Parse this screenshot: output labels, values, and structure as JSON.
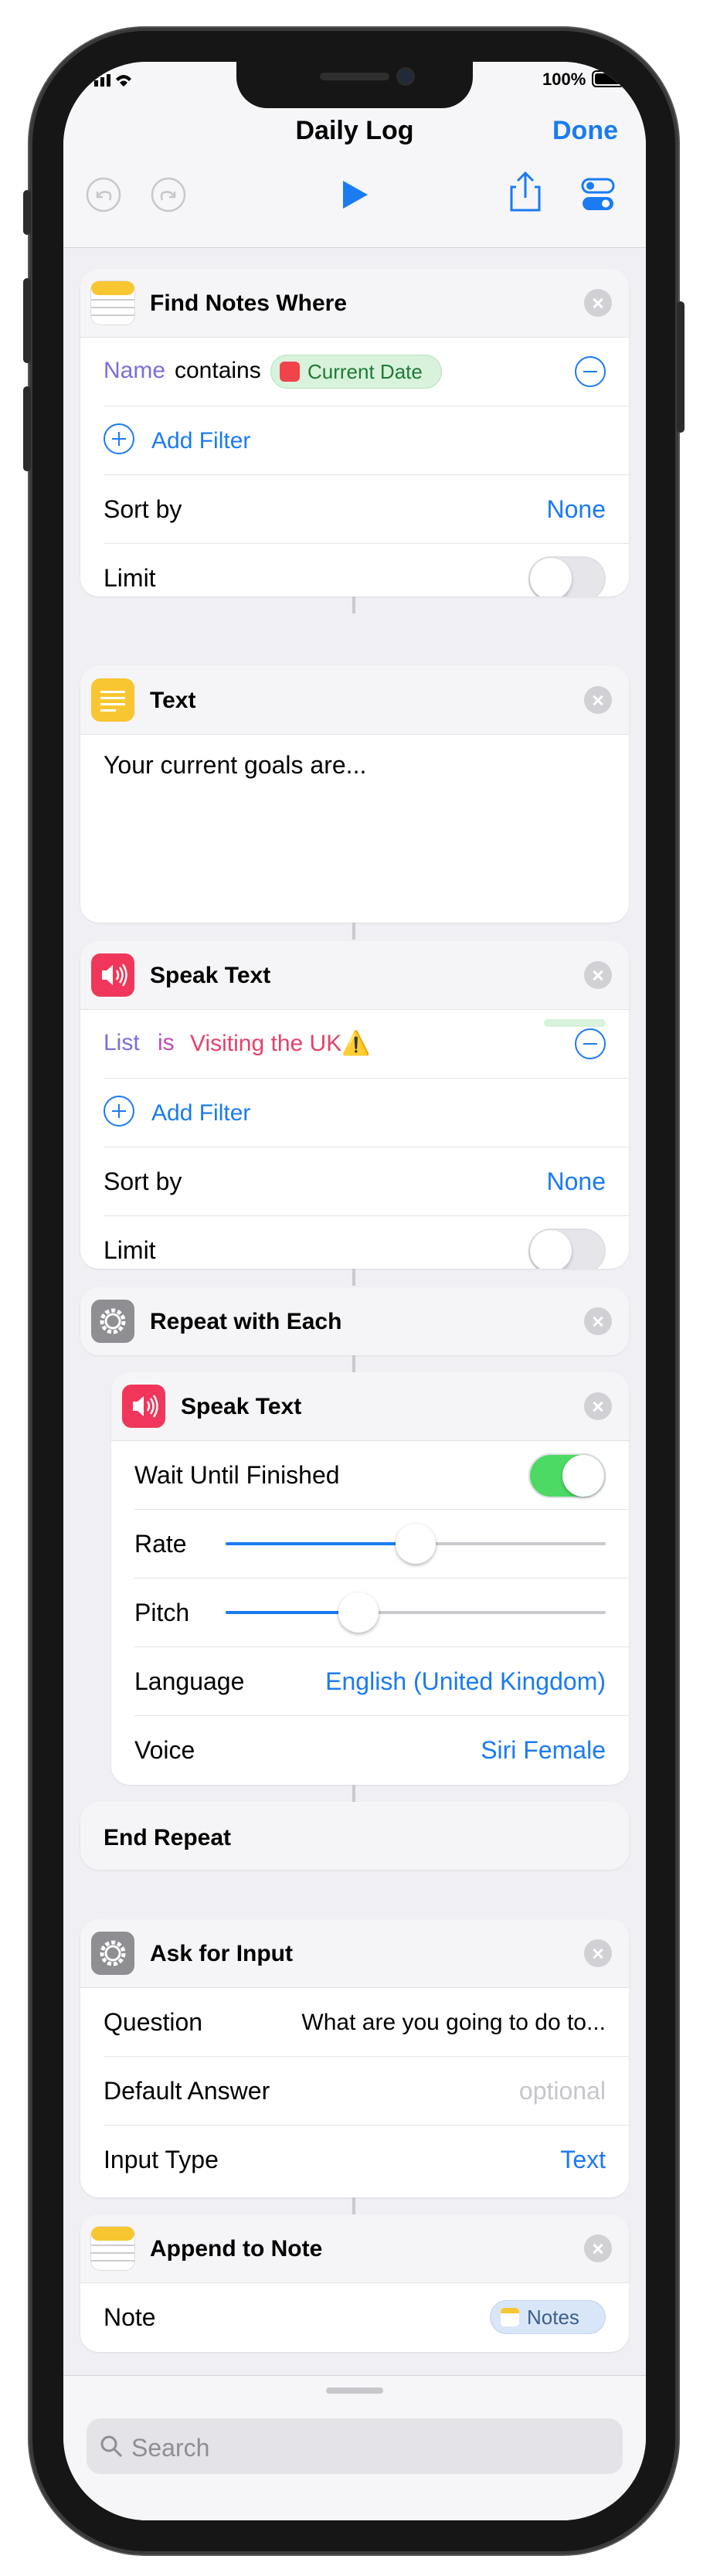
{
  "status_bar": {
    "battery": "100%"
  },
  "nav": {
    "title": "Daily Log",
    "done_label": "Done"
  },
  "toolbar": {
    "icons": [
      "undo-icon",
      "redo-icon",
      "play-icon",
      "share-icon",
      "settings-toggle-icon"
    ],
    "accent": "#1a7bf2"
  },
  "find_notes": {
    "title": "Find Notes Where",
    "filter": {
      "field": "Name",
      "operator": "contains",
      "value": "Current Date"
    },
    "add_filter": "Add Filter",
    "sort_label": "Sort by",
    "sort_value": "None",
    "limit_label": "Limit",
    "limit_on": false
  },
  "text_action": {
    "title": "Text",
    "body": "Your current goals are..."
  },
  "speak_text_1": {
    "title": "Speak Text",
    "filter": {
      "field": "List",
      "operator": "is",
      "value": "Visiting the UK⚠️"
    },
    "add_filter": "Add Filter",
    "sort_label": "Sort by",
    "sort_value": "None",
    "limit_label": "Limit",
    "limit_on": false
  },
  "repeat": {
    "title": "Repeat with Each",
    "end_label": "End Repeat"
  },
  "speak_text_2": {
    "title": "Speak Text",
    "wait_label": "Wait Until Finished",
    "wait_on": true,
    "rate_label": "Rate",
    "rate_level": 0.5,
    "pitch_label": "Pitch",
    "pitch_level": 0.35,
    "language_label": "Language",
    "language_value": "English (United Kingdom)",
    "voice_label": "Voice",
    "voice_value": "Siri Female"
  },
  "ask_input": {
    "title": "Ask for Input",
    "question_label": "Question",
    "question_value": "What are you going to do to...",
    "default_label": "Default Answer",
    "default_placeholder": "optional",
    "type_label": "Input Type",
    "type_value": "Text"
  },
  "append_note": {
    "title": "Append to Note",
    "note_label": "Note",
    "note_value": "Notes"
  },
  "search": {
    "placeholder": "Search"
  }
}
